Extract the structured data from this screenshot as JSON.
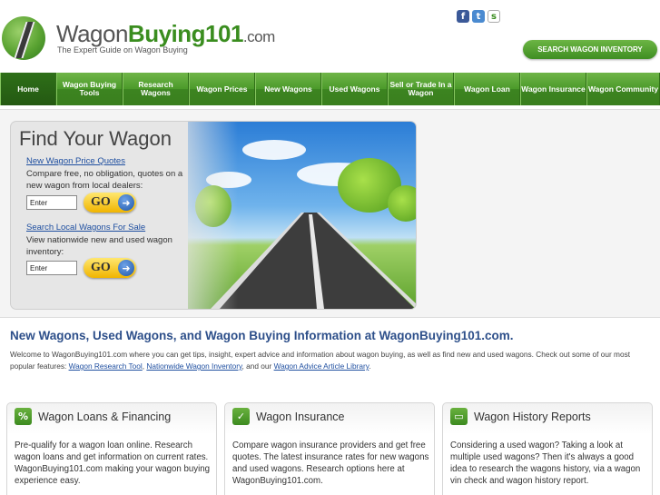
{
  "header": {
    "logo_part1": "Wagon",
    "logo_part2": "Buying101",
    "logo_part3": ".com",
    "tagline": "The Expert Guide on Wagon Buying",
    "search_inventory_label": "SEARCH WAGON INVENTORY",
    "social": [
      {
        "icon": "facebook-icon",
        "glyph": "f"
      },
      {
        "icon": "twitter-icon",
        "glyph": "t"
      },
      {
        "icon": "site-logo-icon",
        "glyph": "s"
      }
    ]
  },
  "nav": {
    "items": [
      {
        "label": "Home"
      },
      {
        "label": "Wagon Buying Tools"
      },
      {
        "label": "Research Wagons"
      },
      {
        "label": "Wagon Prices"
      },
      {
        "label": "New Wagons"
      },
      {
        "label": "Used Wagons"
      },
      {
        "label": "Sell or Trade In a Wagon"
      },
      {
        "label": "Wagon Loan"
      },
      {
        "label": "Wagon Insurance"
      },
      {
        "label": "Wagon Community"
      }
    ]
  },
  "hero": {
    "title": "Find Your Wagon",
    "quotes_link": "New Wagon Price Quotes",
    "quotes_text": "Compare free, no obligation, quotes on a new wagon from local dealers:",
    "quotes_input_value": "Enter",
    "search_link": "Search Local Wagons For Sale",
    "search_text": "View nationwide new and used wagon inventory:",
    "search_input_value": "Enter",
    "go_label": "GO"
  },
  "welcome": {
    "title": "New Wagons, Used Wagons, and Wagon Buying Information at WagonBuying101.com.",
    "text_before": "Welcome to WagonBuying101.com where you can get tips, insight, expert advice and information about wagon buying, as well as find new and used wagons.  Check out some of our most popular features: ",
    "link1": "Wagon Research Tool",
    "sep1": ", ",
    "link2": "Nationwide Wagon Inventory",
    "sep2": ", and our ",
    "link3": "Wagon Advice Article Library",
    "end": "."
  },
  "cards": [
    {
      "icon": "percent-icon",
      "glyph": "%",
      "title": "Wagon Loans & Financing",
      "text": "Pre-qualify for a wagon loan online. Research wagon loans and get information on current rates. WagonBuying101.com making your wagon buying experience easy."
    },
    {
      "icon": "checkmark-icon",
      "glyph": "✓",
      "title": "Wagon Insurance",
      "text": "Compare wagon insurance providers and get free quotes. The latest insurance rates for new wagons and used wagons. Research options here at WagonBuying101.com."
    },
    {
      "icon": "document-icon",
      "glyph": "▭",
      "title": "Wagon History Reports",
      "text": "Considering a used wagon? Taking a look at multiple used wagons? Then it's always a good idea to research the wagons history, via a wagon vin check and wagon history report."
    }
  ],
  "colors": {
    "brand_green": "#3a8d1f",
    "link_blue": "#1f4fa0",
    "heading_blue": "#2d4f8a",
    "go_yellow": "#f0b400"
  }
}
